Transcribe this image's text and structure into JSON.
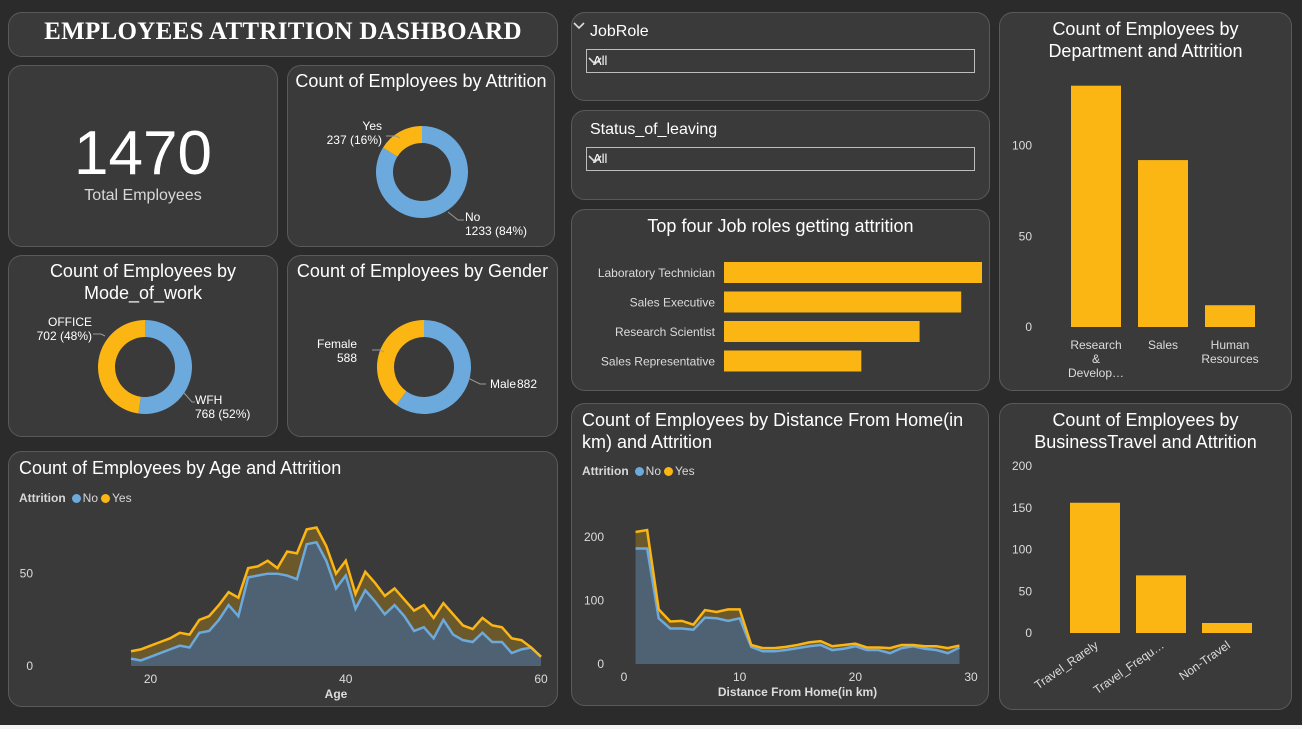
{
  "header": {
    "title": "EMPLOYEES ATTRITION DASHBOARD"
  },
  "colors": {
    "no": "#6ca9dc",
    "yes": "#fcb614",
    "card": "#3a3a3a",
    "bg": "#2b2b2b"
  },
  "kpi": {
    "value": "1470",
    "label": "Total Employees"
  },
  "slicers": [
    {
      "title": "JobRole",
      "value": "All",
      "icon": "chevron-down-icon"
    },
    {
      "title": "Status_of_leaving",
      "value": "All",
      "icon": "chevron-down-icon"
    }
  ],
  "legend": {
    "title": "Attrition",
    "no": "No",
    "yes": "Yes"
  },
  "chart_data": [
    {
      "id": "attrition",
      "type": "pie",
      "title": "Count of Employees by Attrition",
      "slices": [
        {
          "label": "No",
          "value": 1233,
          "pct": "84%",
          "text": "1233 (84%)",
          "color": "#6ca9dc"
        },
        {
          "label": "Yes",
          "value": 237,
          "pct": "16%",
          "text": "237 (16%)",
          "color": "#fcb614"
        }
      ]
    },
    {
      "id": "mode",
      "type": "pie",
      "title": "Count of Employees by Mode_of_work",
      "slices": [
        {
          "label": "WFH",
          "value": 768,
          "pct": "52%",
          "text": "768 (52%)",
          "color": "#6ca9dc"
        },
        {
          "label": "OFFICE",
          "value": 702,
          "pct": "48%",
          "text": "702 (48%)",
          "color": "#fcb614"
        }
      ]
    },
    {
      "id": "gender",
      "type": "pie",
      "title": "Count of Employees by Gender",
      "slices": [
        {
          "label": "Male",
          "value": 882,
          "text": "882",
          "color": "#6ca9dc"
        },
        {
          "label": "Female",
          "value": 588,
          "text": "588",
          "color": "#fcb614"
        }
      ]
    },
    {
      "id": "jobroles",
      "type": "bar",
      "orientation": "horizontal",
      "title": "Top four Job roles getting attrition",
      "categories": [
        "Laboratory Technician",
        "Sales Executive",
        "Research Scientist",
        "Sales Representative"
      ],
      "values": [
        62,
        57,
        47,
        33
      ],
      "color": "#fcb614"
    },
    {
      "id": "department",
      "type": "bar",
      "title": "Count of Employees by Department and Attrition",
      "categories": [
        "Research & Develop…",
        "Sales",
        "Human Resources"
      ],
      "values": [
        133,
        92,
        12
      ],
      "ylim": [
        0,
        140
      ],
      "yticks": [
        0,
        50,
        100
      ],
      "color": "#fcb614"
    },
    {
      "id": "travel",
      "type": "bar",
      "title": "Count of Employees by BusinessTravel and Attrition",
      "categories": [
        "Travel_Rarely",
        "Travel_Frequ…",
        "Non-Travel"
      ],
      "values": [
        156,
        69,
        12
      ],
      "ylim": [
        0,
        200
      ],
      "yticks": [
        0,
        50,
        100,
        150,
        200
      ],
      "color": "#fcb614"
    },
    {
      "id": "age",
      "type": "area",
      "title": "Count of Employees by Age and Attrition",
      "xlabel": "Age",
      "ylabel": "",
      "xlim": [
        18,
        60
      ],
      "ylim": [
        0,
        78
      ],
      "xticks": [
        20,
        40,
        60
      ],
      "yticks": [
        0,
        50
      ],
      "x": [
        18,
        19,
        20,
        21,
        22,
        23,
        24,
        25,
        26,
        27,
        28,
        29,
        30,
        31,
        32,
        33,
        34,
        35,
        36,
        37,
        38,
        39,
        40,
        41,
        42,
        43,
        44,
        45,
        46,
        47,
        48,
        49,
        50,
        51,
        52,
        53,
        54,
        55,
        56,
        57,
        58,
        59,
        60
      ],
      "series": [
        {
          "name": "No",
          "values": [
            4,
            3,
            5,
            7,
            9,
            11,
            10,
            18,
            19,
            25,
            33,
            27,
            48,
            49,
            50,
            50,
            49,
            47,
            66,
            67,
            57,
            42,
            49,
            31,
            41,
            35,
            28,
            33,
            27,
            19,
            21,
            15,
            25,
            17,
            14,
            13,
            18,
            13,
            13,
            7,
            9,
            10,
            5
          ]
        },
        {
          "name": "Yes",
          "values": [
            8,
            9,
            11,
            13,
            15,
            18,
            17,
            25,
            27,
            33,
            40,
            37,
            53,
            54,
            57,
            53,
            62,
            61,
            74,
            75,
            65,
            50,
            57,
            39,
            51,
            45,
            38,
            42,
            36,
            30,
            33,
            26,
            34,
            28,
            22,
            20,
            26,
            22,
            21,
            15,
            14,
            10,
            5
          ]
        }
      ]
    },
    {
      "id": "distance",
      "type": "area",
      "title": "Count of Employees by Distance From Home(in km) and Attrition",
      "xlabel": "Distance From Home(in km)",
      "ylabel": "",
      "xlim": [
        0,
        30
      ],
      "ylim": [
        0,
        230
      ],
      "xticks": [
        0,
        10,
        20,
        30
      ],
      "yticks": [
        0,
        100,
        200
      ],
      "x": [
        1,
        2,
        3,
        4,
        5,
        6,
        7,
        8,
        9,
        10,
        11,
        12,
        13,
        14,
        15,
        16,
        17,
        18,
        19,
        20,
        21,
        22,
        23,
        24,
        25,
        26,
        27,
        28,
        29
      ],
      "series": [
        {
          "name": "No",
          "values": [
            182,
            182,
            72,
            56,
            56,
            54,
            73,
            72,
            68,
            72,
            27,
            20,
            20,
            22,
            25,
            28,
            30,
            22,
            24,
            28,
            22,
            22,
            17,
            25,
            28,
            24,
            22,
            17,
            26
          ]
        },
        {
          "name": "Yes",
          "values": [
            208,
            211,
            86,
            67,
            68,
            62,
            85,
            82,
            86,
            86,
            30,
            25,
            25,
            27,
            30,
            34,
            36,
            28,
            30,
            32,
            26,
            26,
            25,
            30,
            30,
            28,
            28,
            25,
            29
          ]
        }
      ]
    }
  ]
}
